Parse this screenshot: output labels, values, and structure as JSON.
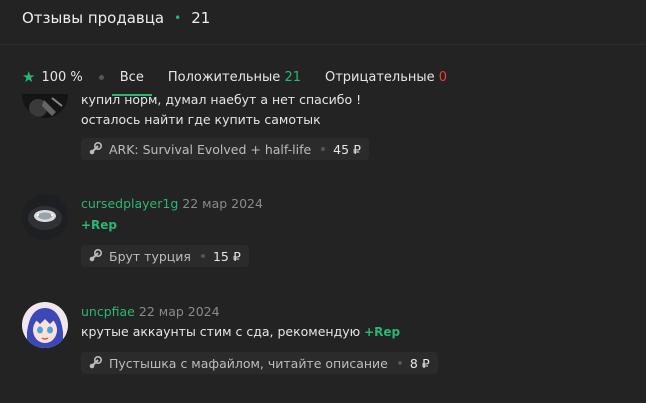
{
  "header": {
    "title": "Отзывы продавца",
    "count": "21"
  },
  "tabs": {
    "rating": "100 %",
    "all": "Все",
    "positive_label": "Положительные",
    "positive_count": "21",
    "negative_label": "Отрицательные",
    "negative_count": "0"
  },
  "reviews": [
    {
      "text_line1": "купил норм, думал наебут а нет спасибо !",
      "text_line2": "осталось найти где купить самотык",
      "product": "ARK: Survival Evolved + half-life",
      "price": "45 ₽"
    },
    {
      "user": "cursedplayer1g",
      "date": "22 мар 2024",
      "rep": "+Rep",
      "product": "Брут турция",
      "price": "15 ₽"
    },
    {
      "user": "uncpfiae",
      "date": "22 мар 2024",
      "text": "крутые аккаунты стим с сда, рекомендую",
      "rep": "+Rep",
      "product": "Пустышка с мафайлом, читайте описание",
      "price": "8 ₽"
    }
  ],
  "colors": {
    "accent": "#2bb673",
    "negative": "#e0443c",
    "background": "#232323"
  },
  "icons": [
    "star-icon",
    "steam-icon"
  ]
}
